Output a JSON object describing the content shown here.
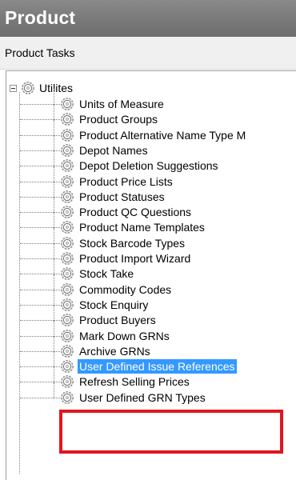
{
  "header": {
    "title": "Product"
  },
  "tasks": {
    "label": "Product Tasks"
  },
  "tree": {
    "root": {
      "label": "Utilites",
      "expanded": true,
      "icon": "gear-icon"
    },
    "items": [
      {
        "label": "Units of Measure",
        "icon": "gear-icon",
        "selected": false
      },
      {
        "label": "Product Groups",
        "icon": "gear-icon",
        "selected": false
      },
      {
        "label": "Product Alternative Name Type M",
        "icon": "gear-icon",
        "selected": false
      },
      {
        "label": "Depot Names",
        "icon": "gear-icon",
        "selected": false
      },
      {
        "label": "Depot Deletion Suggestions",
        "icon": "gear-icon",
        "selected": false
      },
      {
        "label": "Product Price Lists",
        "icon": "gear-icon",
        "selected": false
      },
      {
        "label": "Product Statuses",
        "icon": "gear-icon",
        "selected": false
      },
      {
        "label": "Product QC Questions",
        "icon": "gear-icon",
        "selected": false
      },
      {
        "label": "Product Name Templates",
        "icon": "gear-icon",
        "selected": false
      },
      {
        "label": "Stock Barcode Types",
        "icon": "gear-icon",
        "selected": false
      },
      {
        "label": "Product Import Wizard",
        "icon": "gear-icon",
        "selected": false
      },
      {
        "label": "Stock Take",
        "icon": "gear-icon",
        "selected": false
      },
      {
        "label": "Commodity Codes",
        "icon": "gear-icon",
        "selected": false
      },
      {
        "label": "Stock Enquiry",
        "icon": "gear-icon",
        "selected": false
      },
      {
        "label": "Product Buyers",
        "icon": "gear-icon",
        "selected": false
      },
      {
        "label": "Mark Down GRNs",
        "icon": "gear-icon",
        "selected": false
      },
      {
        "label": "Archive GRNs",
        "icon": "gear-icon",
        "selected": false
      },
      {
        "label": "User Defined Issue References",
        "icon": "gear-icon",
        "selected": true
      },
      {
        "label": "Refresh Selling Prices",
        "icon": "gear-icon",
        "selected": false
      },
      {
        "label": "User Defined GRN Types",
        "icon": "gear-icon",
        "selected": false
      }
    ]
  },
  "colors": {
    "header_bg": "#7a7a7a",
    "selection_bg": "#3399ff",
    "annotation_red": "#e0161e"
  }
}
